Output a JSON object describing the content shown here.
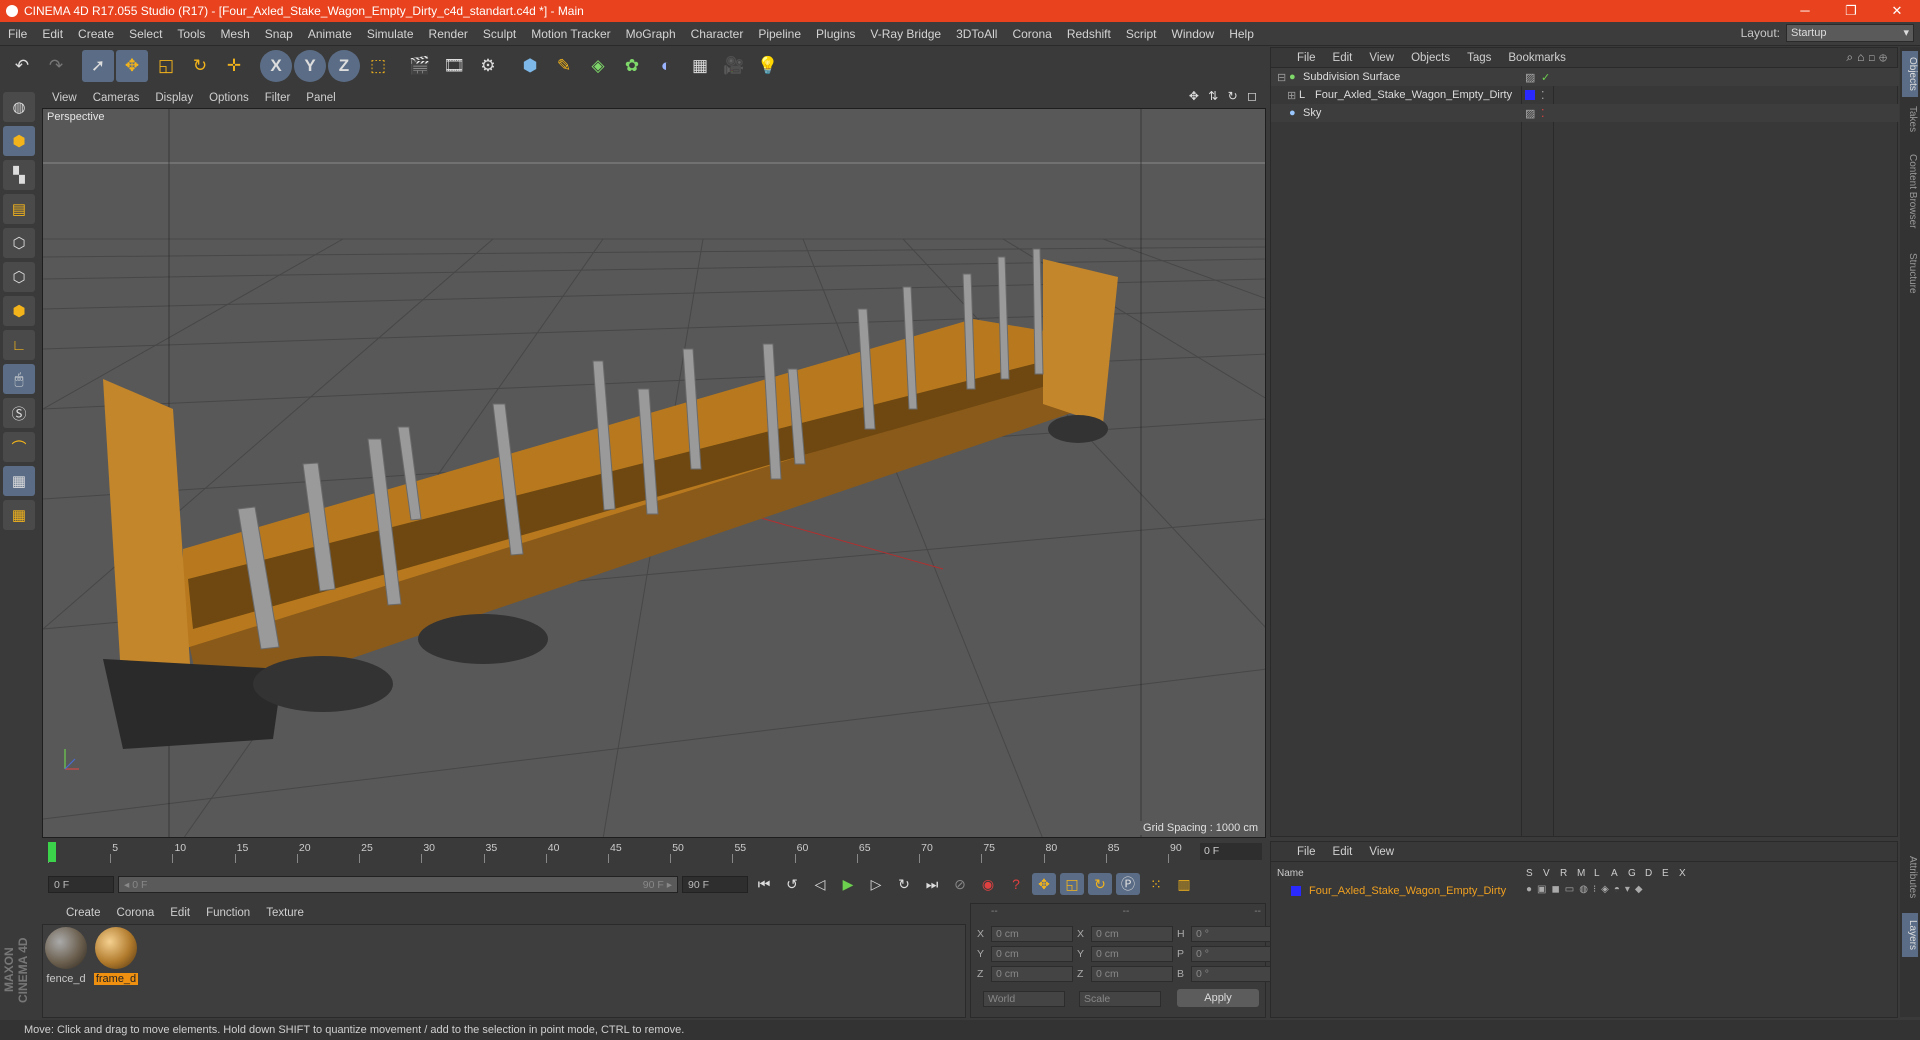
{
  "window": {
    "title": "CINEMA 4D R17.055 Studio (R17) - [Four_Axled_Stake_Wagon_Empty_Dirty_c4d_standart.c4d *] - Main",
    "controls": [
      "─",
      "❐",
      "✕"
    ]
  },
  "menu": [
    "File",
    "Edit",
    "Create",
    "Select",
    "Tools",
    "Mesh",
    "Snap",
    "Animate",
    "Simulate",
    "Render",
    "Sculpt",
    "Motion Tracker",
    "MoGraph",
    "Character",
    "Pipeline",
    "Plugins",
    "V-Ray Bridge",
    "3DToAll",
    "Corona",
    "Redshift",
    "Script",
    "Window",
    "Help"
  ],
  "layout": {
    "label": "Layout:",
    "value": "Startup"
  },
  "toolbar": {
    "x": "X",
    "y": "Y",
    "z": "Z"
  },
  "viewport": {
    "menu": [
      "View",
      "Cameras",
      "Display",
      "Options",
      "Filter",
      "Panel"
    ],
    "label": "Perspective",
    "grid_spacing": "Grid Spacing : 1000 cm",
    "nav": "✥ ⇅ ↻ ◻"
  },
  "timeline": {
    "ticks": [
      "0",
      "5",
      "10",
      "15",
      "20",
      "25",
      "30",
      "35",
      "40",
      "45",
      "50",
      "55",
      "60",
      "65",
      "70",
      "75",
      "80",
      "85",
      "90"
    ],
    "current": "0 F"
  },
  "playback": {
    "start": "0 F",
    "range_start": "◂ 0 F",
    "range_end": "90 F ▸",
    "end": "90 F"
  },
  "materials": {
    "menu": [
      "Create",
      "Corona",
      "Edit",
      "Function",
      "Texture"
    ],
    "items": [
      {
        "name": "fence_d",
        "color": "#6b5f4e"
      },
      {
        "name": "frame_d",
        "color": "#b07a2c",
        "selected": true
      }
    ]
  },
  "coords": {
    "header": [
      "--",
      "--",
      "--"
    ],
    "rows": [
      {
        "a": "X",
        "av": "0 cm",
        "b": "X",
        "bv": "0 cm",
        "c": "H",
        "cv": "0 °"
      },
      {
        "a": "Y",
        "av": "0 cm",
        "b": "Y",
        "bv": "0 cm",
        "c": "P",
        "cv": "0 °"
      },
      {
        "a": "Z",
        "av": "0 cm",
        "b": "Z",
        "bv": "0 cm",
        "c": "B",
        "cv": "0 °"
      }
    ],
    "world": "World",
    "scale": "Scale",
    "apply": "Apply"
  },
  "objects": {
    "menu": [
      "File",
      "Edit",
      "View",
      "Objects",
      "Tags",
      "Bookmarks"
    ],
    "items": [
      {
        "name": "Subdivision Surface",
        "indent": 0
      },
      {
        "name": "Four_Axled_Stake_Wagon_Empty_Dirty",
        "indent": 1
      },
      {
        "name": "Sky",
        "indent": 0
      }
    ]
  },
  "side_tabs": [
    "Objects",
    "Takes",
    "Content Browser",
    "Structure",
    "Attributes",
    "Layers"
  ],
  "layers": {
    "menu": [
      "File",
      "Edit",
      "View"
    ],
    "columns": [
      "Name",
      "S",
      "V",
      "R",
      "M",
      "L",
      "A",
      "G",
      "D",
      "E",
      "X"
    ],
    "row": "Four_Axled_Stake_Wagon_Empty_Dirty"
  },
  "brand": "MAXON CINEMA 4D",
  "status": "Move: Click and drag to move elements. Hold down SHIFT to quantize movement / add to the selection in point mode, CTRL to remove."
}
